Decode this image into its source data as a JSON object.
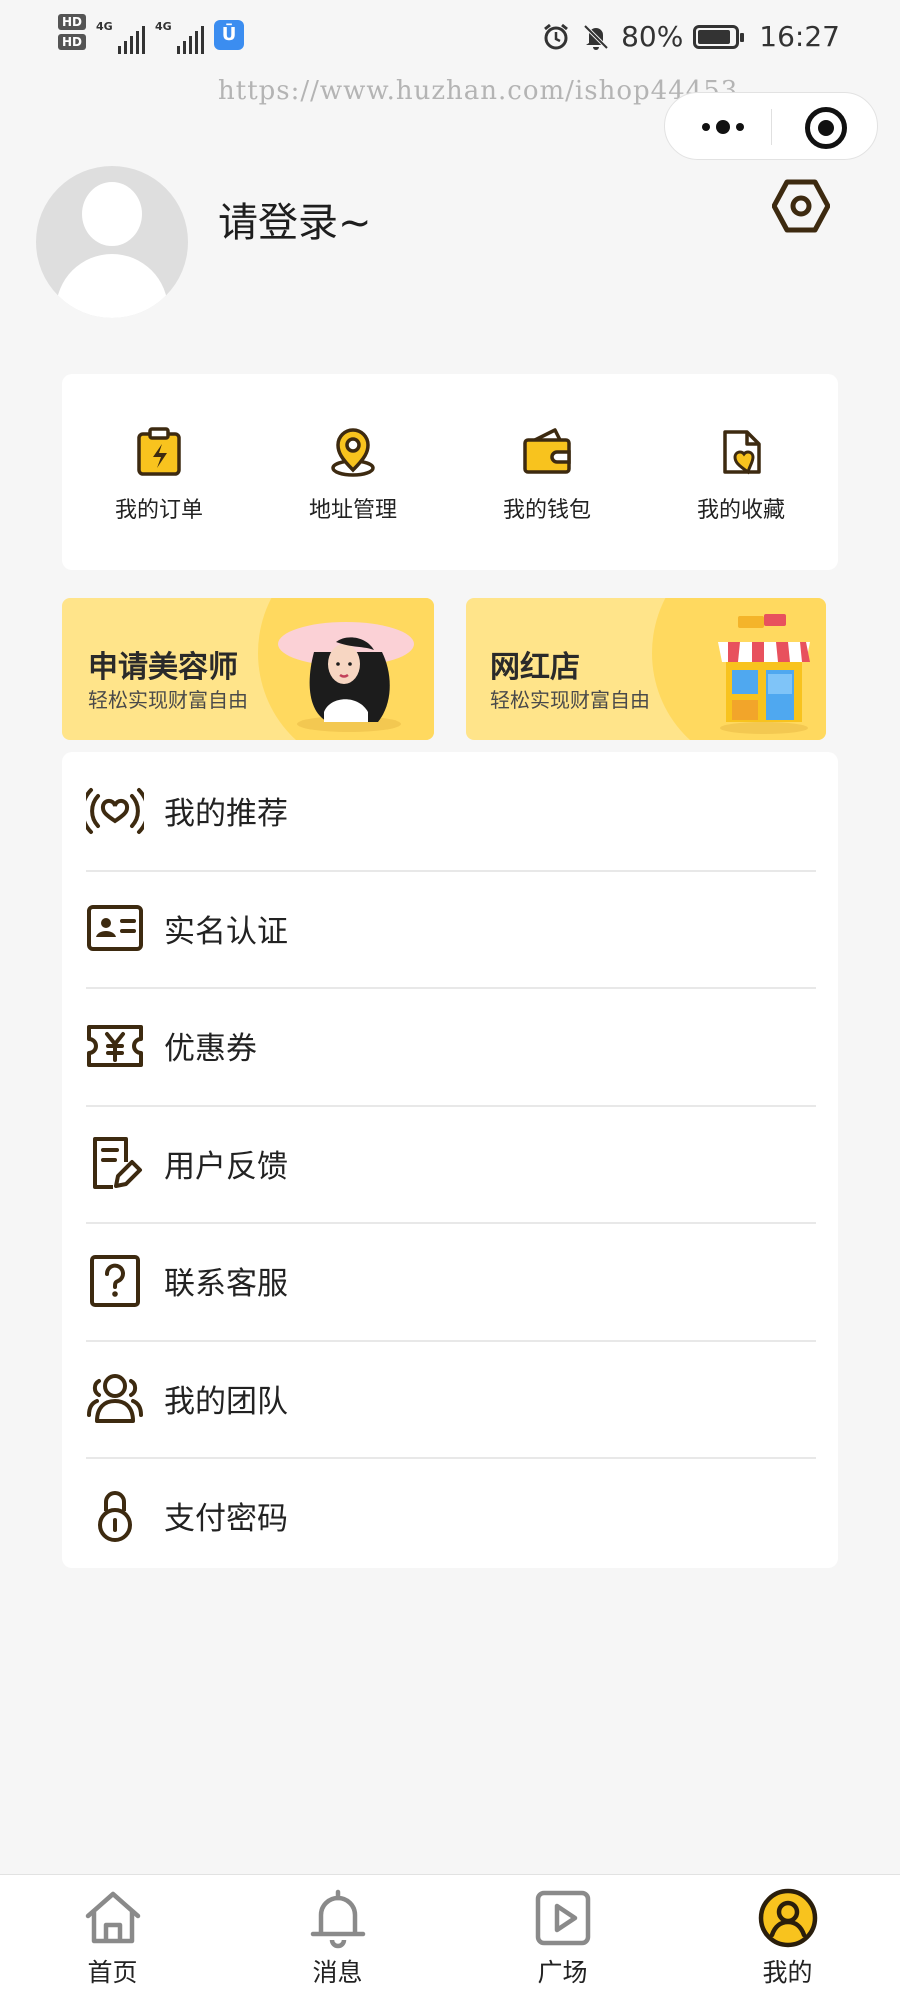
{
  "status_bar": {
    "hd1": "HD",
    "hd2": "HD",
    "net1": "4G",
    "net2": "4G",
    "app_badge": "Ū",
    "battery": "80%",
    "time": "16:27"
  },
  "watermark": "https://www.huzhan.com/ishop44453",
  "profile": {
    "login_text": "请登录~"
  },
  "quick_menu": [
    {
      "label": "我的订单",
      "icon": "order-icon"
    },
    {
      "label": "地址管理",
      "icon": "location-icon"
    },
    {
      "label": "我的钱包",
      "icon": "wallet-icon"
    },
    {
      "label": "我的收藏",
      "icon": "favorite-icon"
    }
  ],
  "banners": [
    {
      "title": "申请美容师",
      "subtitle": "轻松实现财富自由",
      "image": "woman-with-hat"
    },
    {
      "title": "网红店",
      "subtitle": "轻松实现财富自由",
      "image": "storefront"
    }
  ],
  "menu_list": [
    {
      "label": "我的推荐",
      "icon": "broadcast-heart-icon"
    },
    {
      "label": "实名认证",
      "icon": "id-card-icon"
    },
    {
      "label": "优惠券",
      "icon": "coupon-icon"
    },
    {
      "label": "用户反馈",
      "icon": "feedback-icon"
    },
    {
      "label": "联系客服",
      "icon": "help-icon"
    },
    {
      "label": "我的团队",
      "icon": "team-icon"
    },
    {
      "label": "支付密码",
      "icon": "lock-icon"
    }
  ],
  "tabbar": [
    {
      "label": "首页",
      "icon": "home-icon",
      "active": false
    },
    {
      "label": "消息",
      "icon": "bell-icon",
      "active": false
    },
    {
      "label": "广场",
      "icon": "play-icon",
      "active": false
    },
    {
      "label": "我的",
      "icon": "user-icon",
      "active": true
    }
  ],
  "colors": {
    "accent": "#f8c31e",
    "icon_stroke": "#3d2a10",
    "banner_bg": "#ffe48a",
    "page_bg": "#f6f6f6"
  }
}
